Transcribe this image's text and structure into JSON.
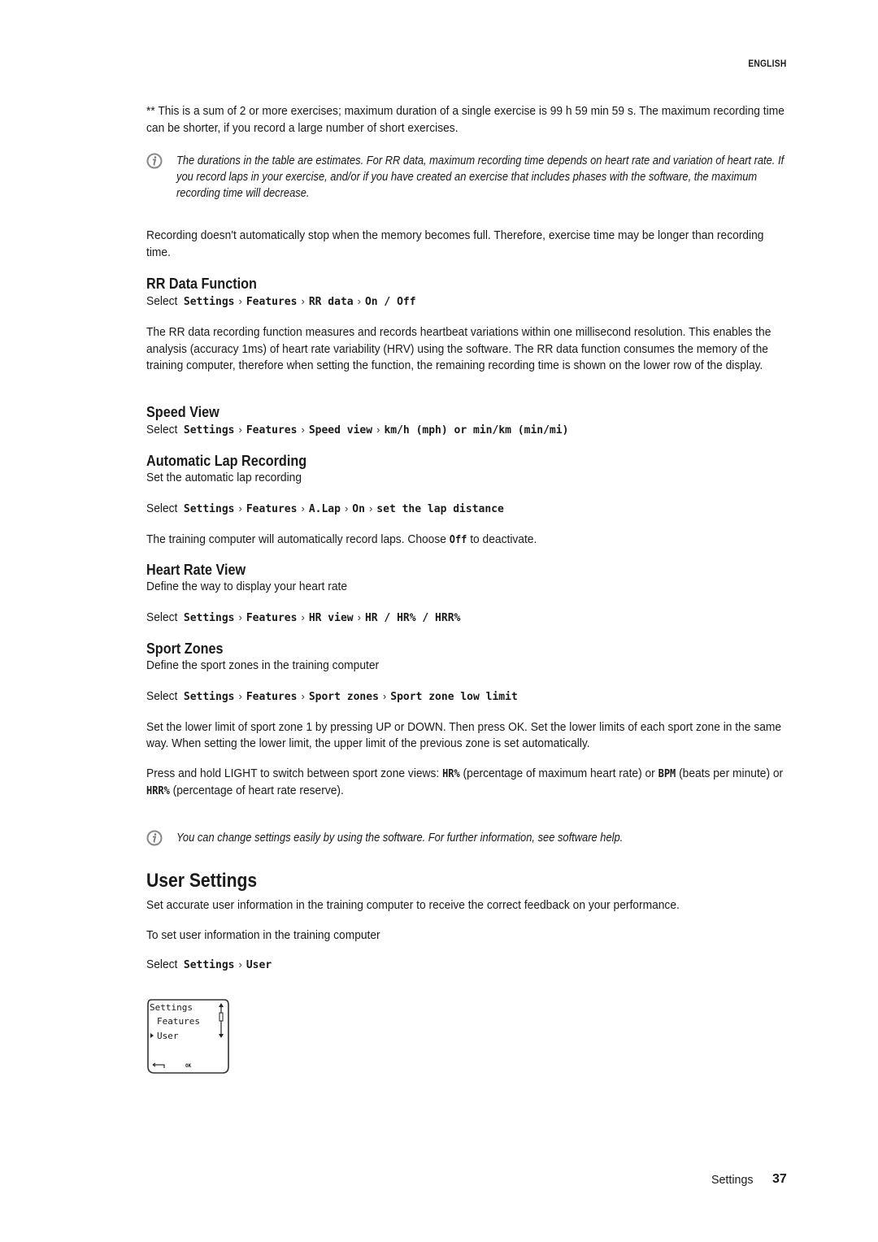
{
  "header": {
    "language": "ENGLISH"
  },
  "intro": {
    "footnote": "** This is a sum of 2 or more exercises; maximum duration of a single exercise is 99 h 59 min 59 s. The maximum recording time can be shorter, if you record a large number of short exercises.",
    "note": "The durations in the table are estimates. For RR data, maximum recording time depends on heart rate and variation of heart rate. If you record laps in your exercise, and/or if you have created an exercise that includes phases with the software, the maximum recording time will decrease.",
    "recording_text": "Recording doesn't automatically stop when the memory becomes full. Therefore, exercise time may be longer than recording time."
  },
  "select_word": "Select",
  "sections": {
    "rr": {
      "title": "RR Data Function",
      "path": [
        "Settings",
        "Features",
        "RR data",
        "On / Off"
      ],
      "body": "The RR data recording function measures and records heartbeat variations within one millisecond resolution. This enables the analysis (accuracy 1ms) of heart rate variability (HRV) using the software. The RR data function consumes the memory of the training computer, therefore when setting the function, the remaining recording time is shown on the lower row of the display."
    },
    "speed": {
      "title": "Speed View",
      "path": [
        "Settings",
        "Features",
        "Speed view",
        "km/h (mph) or min/km (min/mi)"
      ]
    },
    "lap": {
      "title": "Automatic Lap Recording",
      "subtitle": "Set the automatic lap recording",
      "path": [
        "Settings",
        "Features",
        "A.Lap",
        "On",
        "set the lap distance"
      ],
      "body_before": "The training computer will automatically record laps. Choose",
      "body_keyword": "Off",
      "body_after": "to deactivate."
    },
    "hr": {
      "title": "Heart Rate View",
      "subtitle": "Define the way to display your heart rate",
      "path": [
        "Settings",
        "Features",
        "HR view",
        "HR / HR% / HRR%"
      ]
    },
    "zones": {
      "title": "Sport Zones",
      "subtitle": "Define the sport zones in the training computer",
      "path": [
        "Settings",
        "Features",
        "Sport zones",
        "Sport zone low limit"
      ],
      "body1": "Set the lower limit of sport zone 1 by pressing UP or DOWN. Then press OK. Set the lower limits of each sport zone in the same way. When setting the lower limit, the upper limit of the previous zone is set automatically.",
      "body2_a": "Press and hold LIGHT to switch between sport zone views:",
      "body2_k1": "HR%",
      "body2_b": "(percentage of maximum heart rate) or",
      "body2_k2": "BPM",
      "body2_c": "(beats per minute) or",
      "body2_k3": "HRR%",
      "body2_d": "(percentage of heart rate reserve).",
      "note": "You can change settings easily by using the software. For further information, see software help."
    },
    "user": {
      "title": "User Settings",
      "body": "Set accurate user information in the training computer to receive the correct feedback on your performance.",
      "instruction": "To set user information in the training computer",
      "path": [
        "Settings",
        "User"
      ]
    }
  },
  "device_screen": {
    "lines": [
      "Settings",
      "Features",
      "User"
    ],
    "selected_index": 2,
    "back_label": "",
    "ok_label": "OK"
  },
  "footer": {
    "section": "Settings",
    "page_number": "37"
  }
}
